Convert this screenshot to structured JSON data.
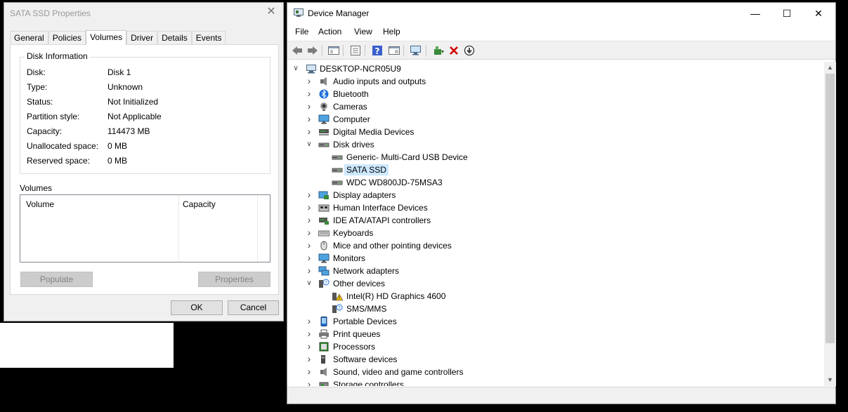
{
  "props": {
    "title": "SATA SSD Properties",
    "tabs": [
      "General",
      "Policies",
      "Volumes",
      "Driver",
      "Details",
      "Events"
    ],
    "active_tab": "Volumes",
    "disk_info_legend": "Disk Information",
    "info": [
      {
        "label": "Disk:",
        "value": "Disk 1"
      },
      {
        "label": "Type:",
        "value": "Unknown"
      },
      {
        "label": "Status:",
        "value": "Not Initialized"
      },
      {
        "label": "Partition style:",
        "value": "Not Applicable"
      },
      {
        "label": "Capacity:",
        "value": "114473 MB"
      },
      {
        "label": "Unallocated space:",
        "value": "0 MB"
      },
      {
        "label": "Reserved space:",
        "value": "0 MB"
      }
    ],
    "volumes_label": "Volumes",
    "volume_columns": [
      "Volume",
      "Capacity"
    ],
    "populate_label": "Populate",
    "properties_label": "Properties",
    "ok_label": "OK",
    "cancel_label": "Cancel"
  },
  "dm": {
    "title": "Device Manager",
    "menu": [
      "File",
      "Action",
      "View",
      "Help"
    ],
    "root": "DESKTOP-NCR05U9",
    "tree": [
      {
        "label": "Audio inputs and outputs",
        "icon": "speaker-icon",
        "level": 1,
        "state": "collapsed"
      },
      {
        "label": "Bluetooth",
        "icon": "bluetooth-icon",
        "level": 1,
        "state": "collapsed"
      },
      {
        "label": "Cameras",
        "icon": "camera-icon",
        "level": 1,
        "state": "collapsed"
      },
      {
        "label": "Computer",
        "icon": "monitor-icon",
        "level": 1,
        "state": "collapsed"
      },
      {
        "label": "Digital Media Devices",
        "icon": "media-device-icon",
        "level": 1,
        "state": "collapsed"
      },
      {
        "label": "Disk drives",
        "icon": "disk-drive-icon",
        "level": 1,
        "state": "expanded"
      },
      {
        "label": "Generic- Multi-Card USB Device",
        "icon": "disk-drive-icon",
        "level": 2,
        "state": "leaf"
      },
      {
        "label": "SATA SSD",
        "icon": "disk-drive-icon",
        "level": 2,
        "state": "leaf",
        "selected": true
      },
      {
        "label": "WDC WD800JD-75MSA3",
        "icon": "disk-drive-icon",
        "level": 2,
        "state": "leaf"
      },
      {
        "label": "Display adapters",
        "icon": "display-adapter-icon",
        "level": 1,
        "state": "collapsed"
      },
      {
        "label": "Human Interface Devices",
        "icon": "hid-icon",
        "level": 1,
        "state": "collapsed"
      },
      {
        "label": "IDE ATA/ATAPI controllers",
        "icon": "ide-controller-icon",
        "level": 1,
        "state": "collapsed"
      },
      {
        "label": "Keyboards",
        "icon": "keyboard-icon",
        "level": 1,
        "state": "collapsed"
      },
      {
        "label": "Mice and other pointing devices",
        "icon": "mouse-icon",
        "level": 1,
        "state": "collapsed"
      },
      {
        "label": "Monitors",
        "icon": "monitor-icon",
        "level": 1,
        "state": "collapsed"
      },
      {
        "label": "Network adapters",
        "icon": "network-adapter-icon",
        "level": 1,
        "state": "collapsed"
      },
      {
        "label": "Other devices",
        "icon": "unknown-device-icon",
        "level": 1,
        "state": "expanded"
      },
      {
        "label": "Intel(R) HD Graphics 4600",
        "icon": "warning-device-icon",
        "level": 2,
        "state": "leaf"
      },
      {
        "label": "SMS/MMS",
        "icon": "unknown-device-icon",
        "level": 2,
        "state": "leaf"
      },
      {
        "label": "Portable Devices",
        "icon": "portable-device-icon",
        "level": 1,
        "state": "collapsed"
      },
      {
        "label": "Print queues",
        "icon": "printer-icon",
        "level": 1,
        "state": "collapsed"
      },
      {
        "label": "Processors",
        "icon": "processor-icon",
        "level": 1,
        "state": "collapsed"
      },
      {
        "label": "Software devices",
        "icon": "software-device-icon",
        "level": 1,
        "state": "collapsed"
      },
      {
        "label": "Sound, video and game controllers",
        "icon": "speaker-icon",
        "level": 1,
        "state": "collapsed"
      },
      {
        "label": "Storage controllers",
        "icon": "storage-controller-icon",
        "level": 1,
        "state": "collapsed"
      }
    ]
  }
}
